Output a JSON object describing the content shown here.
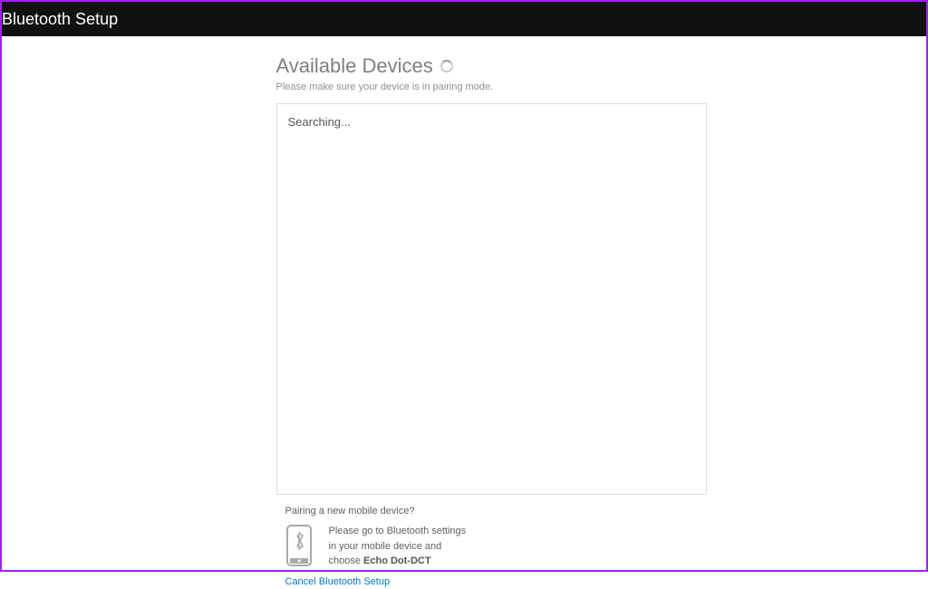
{
  "header": {
    "title": "Bluetooth Setup"
  },
  "main": {
    "title": "Available Devices",
    "subtitle": "Please make sure your device is in pairing mode.",
    "searching_text": "Searching..."
  },
  "footer": {
    "question": "Pairing a new mobile device?",
    "instruction_line1": "Please go to Bluetooth settings",
    "instruction_line2": "in your mobile device and",
    "instruction_line3_prefix": "choose ",
    "device_name": "Echo Dot-DCT",
    "cancel_label": "Cancel Bluetooth Setup"
  }
}
